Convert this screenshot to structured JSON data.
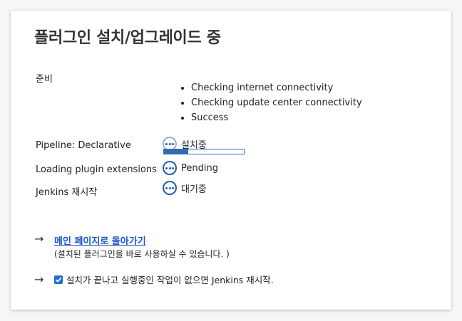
{
  "title": "플러그인 설치/업그레이드 중",
  "prep": {
    "label": "준비",
    "checks": [
      "Checking internet connectivity",
      "Checking update center connectivity",
      "Success"
    ]
  },
  "plugins": [
    {
      "name": "Pipeline: Declarative",
      "status": "설치중",
      "progress": 0.3
    },
    {
      "name": "Loading plugin extensions",
      "status": "Pending"
    },
    {
      "name": "Jenkins 재시작",
      "status": "대기중"
    }
  ],
  "back": {
    "link": "메인 페이지로 돌아가기",
    "hint": "(설치된 플러그인을 바로 사용하실 수 있습니다. )"
  },
  "restart": {
    "label": "설치가 끝나고 실행중인 작업이 없으면 Jenkins 재시작.",
    "checked": true
  },
  "colors": {
    "accent": "#1f5faa",
    "link": "#1a55c6"
  },
  "icons": {
    "arrow": "→"
  }
}
